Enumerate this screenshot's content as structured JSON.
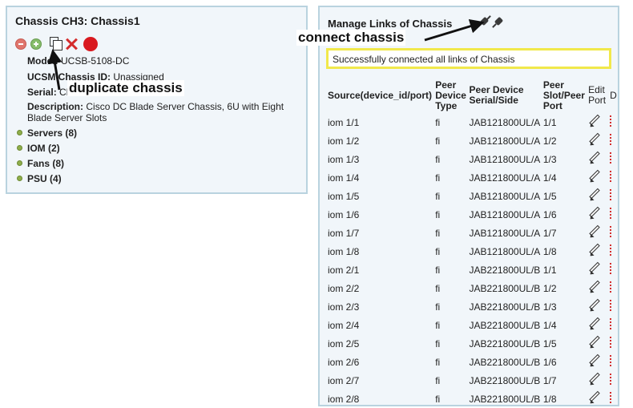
{
  "left_panel": {
    "title": "Chassis CH3: Chassis1",
    "model_label": "Model:",
    "model_value": "UCSB-5108-DC",
    "ucsm_label": "UCSM Chassis ID:",
    "ucsm_value": "Unassigned",
    "serial_label": "Serial:",
    "serial_value": "Cl",
    "description_label": "Description:",
    "description_value": "Cisco DC Blade Server Chassis, 6U with Eight Blade Server Slots",
    "groups": [
      {
        "label": "Servers (8)"
      },
      {
        "label": "IOM (2)"
      },
      {
        "label": "Fans (8)"
      },
      {
        "label": "PSU (4)"
      }
    ]
  },
  "right_panel": {
    "title": "Manage Links of Chassis",
    "status_message": "Successfully connected all links of Chassis",
    "columns": {
      "source": "Source(device_id/port)",
      "peer_device_type": "Peer Device Type",
      "peer_serial_side": "Peer Device Serial/Side",
      "peer_slot_port": "Peer Slot/Peer Port",
      "edit_port": "Edit Port",
      "delete": "D"
    },
    "rows": [
      {
        "source": "iom 1/1",
        "type": "fi",
        "serial": "JAB121800UL/A",
        "slot": "1/1"
      },
      {
        "source": "iom 1/2",
        "type": "fi",
        "serial": "JAB121800UL/A",
        "slot": "1/2"
      },
      {
        "source": "iom 1/3",
        "type": "fi",
        "serial": "JAB121800UL/A",
        "slot": "1/3"
      },
      {
        "source": "iom 1/4",
        "type": "fi",
        "serial": "JAB121800UL/A",
        "slot": "1/4"
      },
      {
        "source": "iom 1/5",
        "type": "fi",
        "serial": "JAB121800UL/A",
        "slot": "1/5"
      },
      {
        "source": "iom 1/6",
        "type": "fi",
        "serial": "JAB121800UL/A",
        "slot": "1/6"
      },
      {
        "source": "iom 1/7",
        "type": "fi",
        "serial": "JAB121800UL/A",
        "slot": "1/7"
      },
      {
        "source": "iom 1/8",
        "type": "fi",
        "serial": "JAB121800UL/A",
        "slot": "1/8"
      },
      {
        "source": "iom 2/1",
        "type": "fi",
        "serial": "JAB221800UL/B",
        "slot": "1/1"
      },
      {
        "source": "iom 2/2",
        "type": "fi",
        "serial": "JAB221800UL/B",
        "slot": "1/2"
      },
      {
        "source": "iom 2/3",
        "type": "fi",
        "serial": "JAB221800UL/B",
        "slot": "1/3"
      },
      {
        "source": "iom 2/4",
        "type": "fi",
        "serial": "JAB221800UL/B",
        "slot": "1/4"
      },
      {
        "source": "iom 2/5",
        "type": "fi",
        "serial": "JAB221800UL/B",
        "slot": "1/5"
      },
      {
        "source": "iom 2/6",
        "type": "fi",
        "serial": "JAB221800UL/B",
        "slot": "1/6"
      },
      {
        "source": "iom 2/7",
        "type": "fi",
        "serial": "JAB221800UL/B",
        "slot": "1/7"
      },
      {
        "source": "iom 2/8",
        "type": "fi",
        "serial": "JAB221800UL/B",
        "slot": "1/8"
      }
    ]
  },
  "annotations": {
    "duplicate": "duplicate chassis",
    "connect": "connect chassis"
  },
  "icons": {
    "remove": "minus-circle-icon",
    "add": "plus-circle-icon",
    "duplicate": "duplicate-icon",
    "delete": "delete-x-icon",
    "stop": "red-dot-icon",
    "connect": "plug-icon",
    "edit": "pencil-icon"
  },
  "colors": {
    "panel_bg": "#f1f6fa",
    "panel_border": "#b9d3df",
    "status_border": "#f1e84b",
    "delete_red": "#d42d2d"
  }
}
